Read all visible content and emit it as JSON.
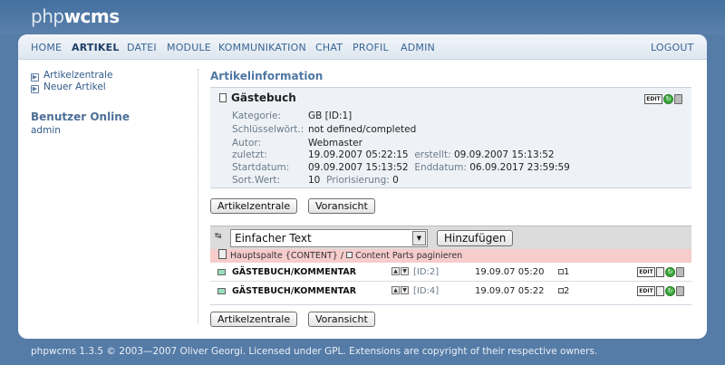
{
  "logo": {
    "part1": "php",
    "part2": "wcms"
  },
  "nav": {
    "items": [
      "HOME",
      "ARTIKEL",
      "DATEI",
      "MODULE",
      "KOMMUNIKATION",
      "CHAT",
      "PROFIL",
      "ADMIN"
    ],
    "active": "ARTIKEL",
    "logout": "LOGOUT"
  },
  "sidebar": {
    "links": [
      "Artikelzentrale",
      "Neuer Artikel"
    ],
    "online_title": "Benutzer Online",
    "online_user": "admin"
  },
  "content": {
    "title": "Artikelinformation",
    "article": {
      "name": "Gästebuch",
      "rows": [
        {
          "label": "Kategorie:",
          "value": "GB [ID:1]"
        },
        {
          "label": "Schlüsselwört.:",
          "value": "not defined/completed"
        },
        {
          "label": "Autor:",
          "value": "Webmaster"
        },
        {
          "label": "zuletzt:",
          "value": "19.09.2007 05:22:15",
          "label2": "erstellt:",
          "value2": "09.09.2007 15:13:52"
        },
        {
          "label": "Startdatum:",
          "value": "09.09.2007 15:13:52",
          "label2": "Enddatum:",
          "value2": "06.09.2017 23:59:59"
        },
        {
          "label": "Sort.Wert:",
          "value": "10",
          "label2": "Priorisierung:",
          "value2": "0"
        }
      ],
      "icons": [
        "edit-icon",
        "go-icon",
        "trash-icon"
      ],
      "edit_label": "EDIT"
    },
    "buttons": {
      "center": "Artikelzentrale",
      "preview": "Voransicht"
    },
    "contentpart": {
      "select_value": "Einfacher Text",
      "add_label": "Hinzufügen"
    },
    "section_label": "Hauptspalte {CONTENT}",
    "section_sep": "/",
    "section_paginate": "Content Parts paginieren",
    "parts": [
      {
        "title": "GÄSTEBUCH/KOMMENTAR",
        "id": "[ID:2]",
        "date": "19.09.07 05:20",
        "count": "1"
      },
      {
        "title": "GÄSTEBUCH/KOMMENTAR",
        "id": "[ID:4]",
        "date": "19.09.07 05:22",
        "count": "2"
      }
    ]
  },
  "footer": "phpwcms 1.3.5 © 2003—2007 Oliver Georgi. Licensed under GPL. Extensions are copyright of their respective owners."
}
